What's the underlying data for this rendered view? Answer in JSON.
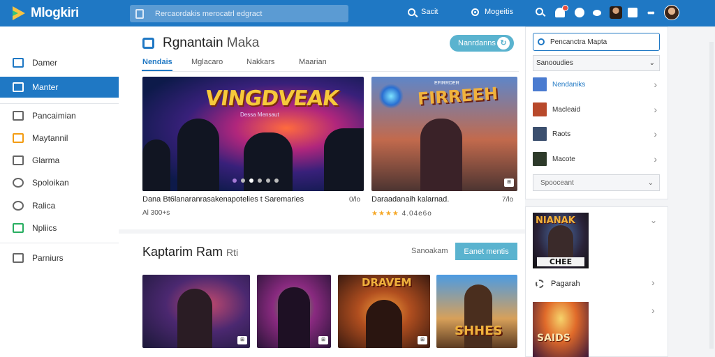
{
  "app": {
    "name": "Mlogkiri"
  },
  "search": {
    "placeholder": "Rercaordakis merocatrl edgract"
  },
  "top_links": {
    "search": "Sacit",
    "profile": "Mogeitis"
  },
  "sidebar": {
    "items": [
      {
        "label": "Damer",
        "icon": "home-icon"
      },
      {
        "label": "Manter",
        "icon": "bookmark-icon",
        "active": true
      },
      {
        "label": "Pancaimian",
        "icon": "list-icon"
      },
      {
        "label": "Maytannil",
        "icon": "flame-icon"
      },
      {
        "label": "Glarma",
        "icon": "grid-icon"
      },
      {
        "label": "Spoloikan",
        "icon": "user-icon"
      },
      {
        "label": "Ralica",
        "icon": "target-icon"
      },
      {
        "label": "Npliics",
        "icon": "puzzle-icon"
      },
      {
        "label": "Parniurs",
        "icon": "document-icon"
      }
    ]
  },
  "main": {
    "title": "Rgnantain",
    "title_light": "Maka",
    "header_button": "Nanrdanns",
    "tabs": [
      "Nendais",
      "Mglacaro",
      "Nakkars",
      "Maarian"
    ],
    "hero": {
      "title": "VINGDVEAK",
      "subtitle": "Dessa Mensaut",
      "caption": "Dana Bt6lanaranrasakenapotelies t Saremaries",
      "caption_right": "0/lo",
      "meta": "Al 300+s"
    },
    "card2": {
      "title": "FIRREEH",
      "subtitle": "EFIRRDER",
      "caption": "Daraadanaih kalarnad.",
      "caption_right": "7/lo",
      "rating_text": "4.04e6o"
    },
    "section": {
      "title": "Kaptarim Ram",
      "title_light": "Rti",
      "link": "Sanoakam",
      "button": "Eanet mentis"
    },
    "thumbs": [
      {
        "title": ""
      },
      {
        "title": ""
      },
      {
        "title": "DRAVEM"
      },
      {
        "title": "SHHES"
      }
    ]
  },
  "right_panel": {
    "search_value": "Pencanctra Mapta",
    "select_value": "Sanooudies",
    "rows": [
      {
        "label": "Nendaniks",
        "color": "#4a7bd0"
      },
      {
        "label": "Macleaid",
        "color": "#b8492b"
      },
      {
        "label": "Raots",
        "color": "#3b4f6e"
      },
      {
        "label": "Macote",
        "color": "#2d3a2a"
      }
    ],
    "select2_value": "Spooceant",
    "card": {
      "title": "NIANAK",
      "label": "CHEE"
    },
    "link": "Pagarah",
    "card2": {
      "title": "SAIDS"
    }
  },
  "colors": {
    "primary": "#1f78c4",
    "accent": "#5ab3cf",
    "star": "#f5a623"
  }
}
